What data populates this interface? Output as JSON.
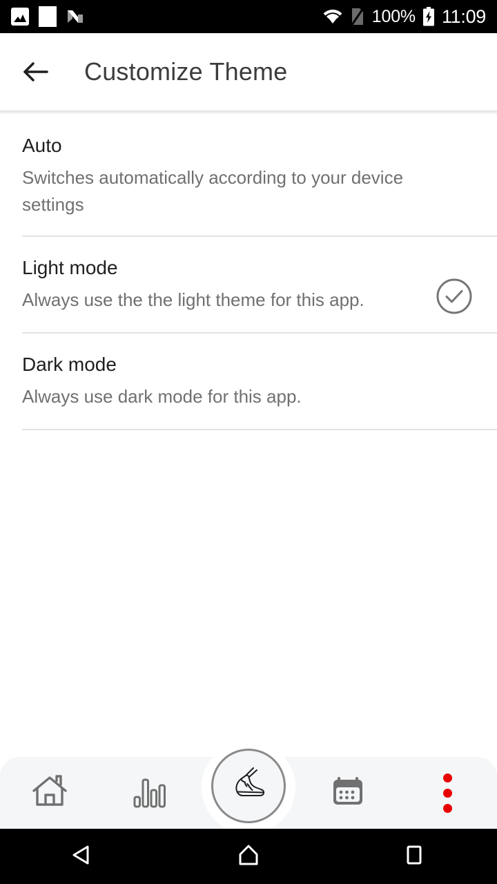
{
  "status_bar": {
    "notification_icons": [
      "image-icon",
      "white-square-icon",
      "android-n-icon"
    ],
    "wifi_icon": "wifi-icon",
    "sim_icon": "no-sim-icon",
    "battery_percent": "100%",
    "battery_icon": "battery-charging-icon",
    "clock": "11:09"
  },
  "app_bar": {
    "back_icon": "back-arrow-icon",
    "title": "Customize Theme"
  },
  "theme_options": [
    {
      "title": "Auto",
      "subtitle": "Switches automatically according to your device settings",
      "selected": false
    },
    {
      "title": "Light mode",
      "subtitle": "Always use the the light theme for this app.",
      "selected": true
    },
    {
      "title": "Dark mode",
      "subtitle": "Always use dark mode for this app.",
      "selected": false
    }
  ],
  "bottom_nav": {
    "items": [
      {
        "icon": "home-icon",
        "label": "Home"
      },
      {
        "icon": "bar-chart-icon",
        "label": "Statistics"
      },
      {
        "icon": "shoe-icon",
        "label": "Activity"
      },
      {
        "icon": "calendar-icon",
        "label": "Calendar"
      },
      {
        "icon": "overflow-menu-icon",
        "label": "More"
      }
    ],
    "accent_color": "#e80000",
    "background_color": "#f4f6f8",
    "icon_color": "#707070"
  },
  "system_nav": {
    "back": "triangle-back-icon",
    "home": "home-pentagon-icon",
    "recents": "square-recents-icon"
  },
  "colors": {
    "background": "#ffffff",
    "status_bar": "#000000",
    "title_text": "#3c3c3c",
    "primary_text": "#1f1f1f",
    "secondary_text": "#707070",
    "divider": "#e3e3e3",
    "check_icon": "#757575"
  }
}
